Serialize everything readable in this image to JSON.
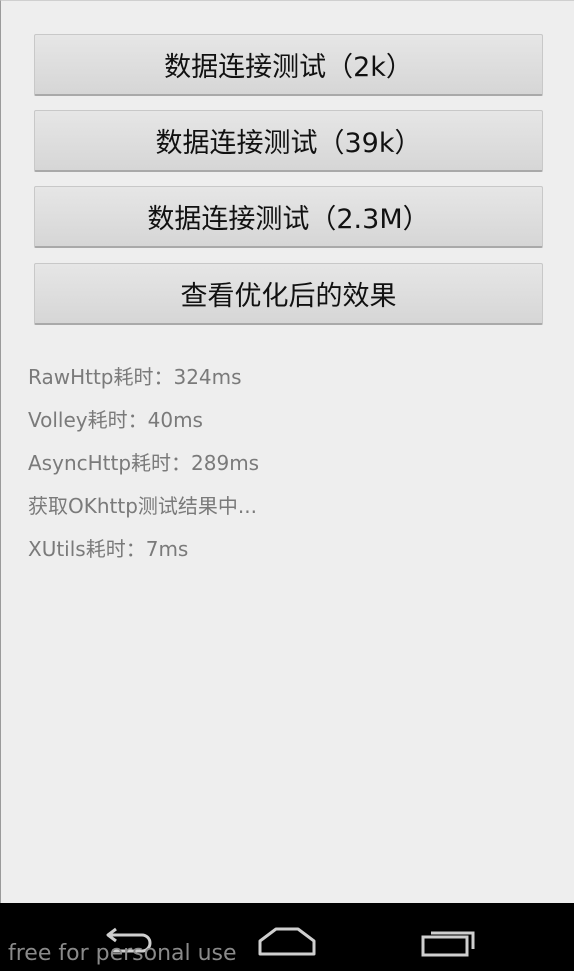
{
  "buttons": [
    {
      "label": "数据连接测试（2k）"
    },
    {
      "label": "数据连接测试（39k）"
    },
    {
      "label": "数据连接测试（2.3M）"
    },
    {
      "label": "查看优化后的效果"
    }
  ],
  "results": [
    "RawHttp耗时：324ms",
    "Volley耗时：40ms",
    "AsyncHttp耗时：289ms",
    "获取OKhttp测试结果中...",
    "XUtils耗时：7ms"
  ],
  "navigation": {
    "icons": [
      "back-icon",
      "home-icon",
      "recent-apps-icon"
    ]
  },
  "watermark": "free for personal use",
  "colors": {
    "background": "#eeeeee",
    "button": "#dcdcdc",
    "result_text": "#7a7a7a",
    "navbar": "#000000"
  }
}
